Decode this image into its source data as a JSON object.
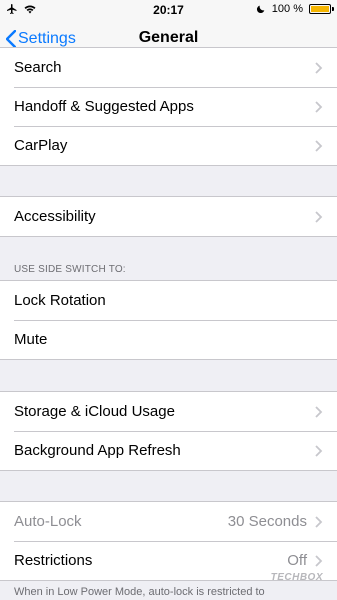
{
  "status_bar": {
    "time": "20:17",
    "battery_text": "100 %",
    "battery_level": 1.0,
    "icons": [
      "airplane-icon",
      "wifi-icon",
      "moon-icon",
      "battery-icon"
    ]
  },
  "nav": {
    "back_label": "Settings",
    "title": "General"
  },
  "groups": {
    "top": [
      {
        "label": "Search"
      },
      {
        "label": "Handoff & Suggested Apps"
      },
      {
        "label": "CarPlay"
      }
    ],
    "accessibility": [
      {
        "label": "Accessibility"
      }
    ],
    "side_switch": {
      "header": "USE SIDE SWITCH TO:",
      "items": [
        {
          "label": "Lock Rotation"
        },
        {
          "label": "Mute"
        }
      ]
    },
    "storage": [
      {
        "label": "Storage & iCloud Usage"
      },
      {
        "label": "Background App Refresh"
      }
    ],
    "lock": [
      {
        "label": "Auto-Lock",
        "value": "30 Seconds"
      },
      {
        "label": "Restrictions",
        "value": "Off"
      }
    ]
  },
  "footer_note": "When in Low Power Mode, auto-lock is restricted to",
  "watermark": "TECHBOX",
  "colors": {
    "accent": "#0a7aff",
    "background": "#efeff4",
    "battery": "#f5b500"
  }
}
